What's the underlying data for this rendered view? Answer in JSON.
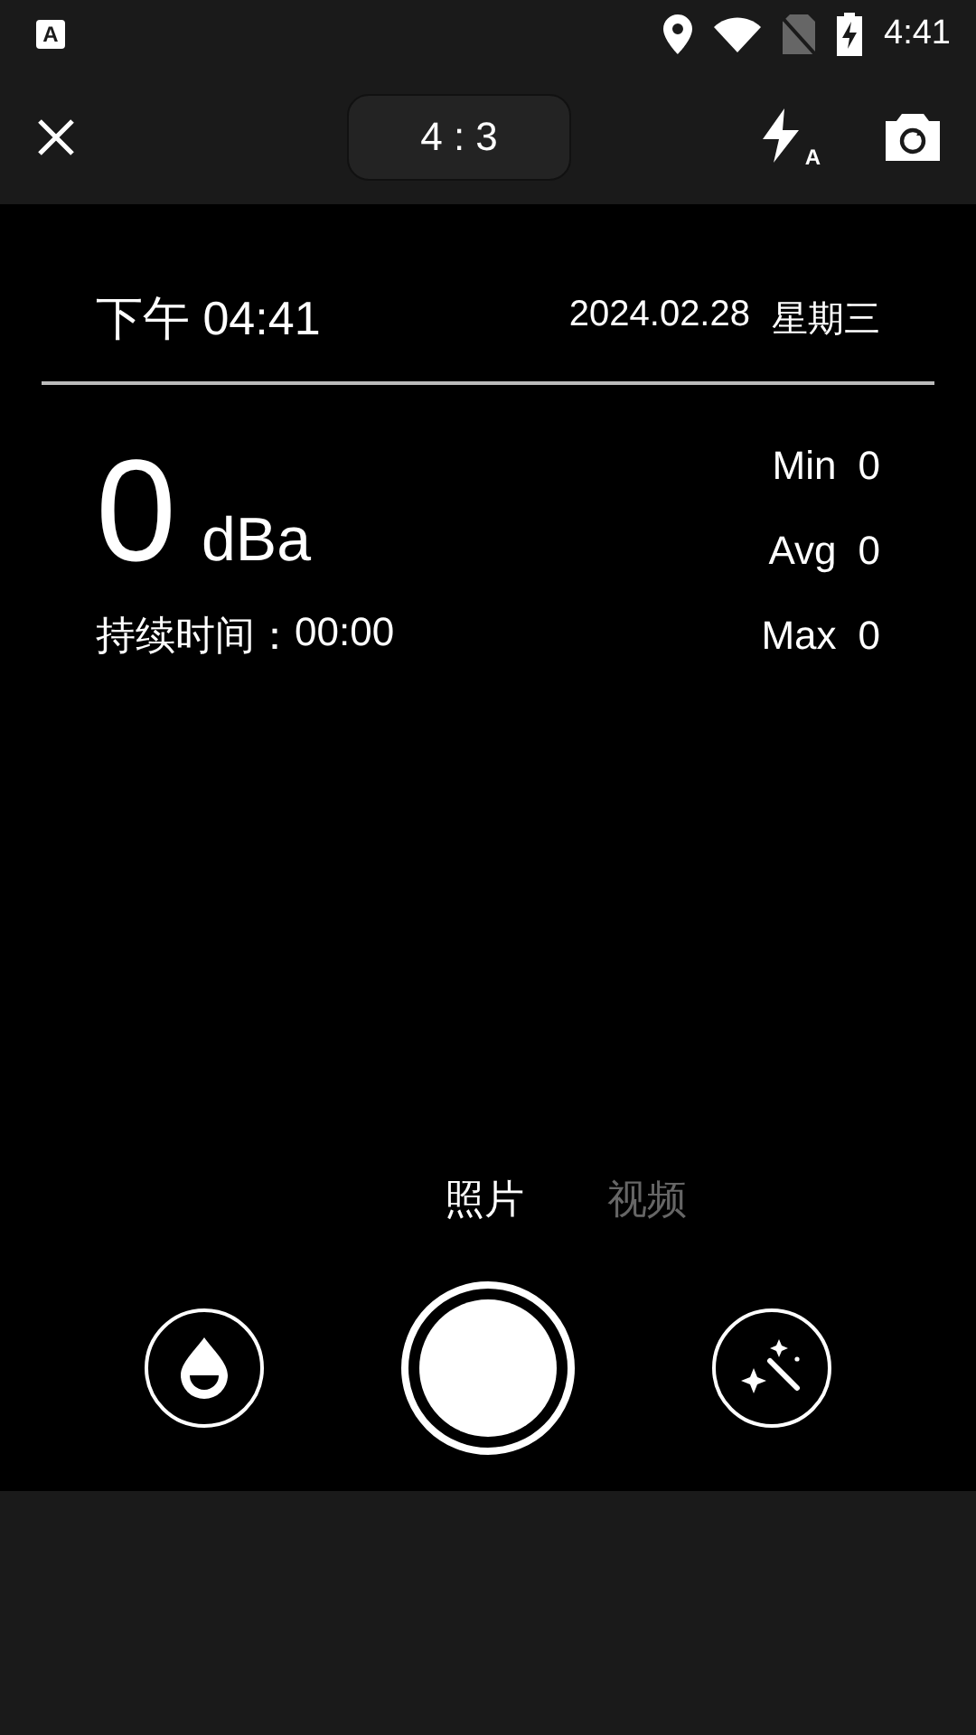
{
  "status_bar": {
    "notification": "A",
    "time": "4:41"
  },
  "top_bar": {
    "aspect_ratio": "4 : 3",
    "flash_mode": "A"
  },
  "meter": {
    "time": "下午 04:41",
    "date": "2024.02.28",
    "weekday": "星期三",
    "value": "0",
    "unit": "dBa",
    "duration_label": "持续时间：",
    "duration": "00:00",
    "stats": [
      {
        "label": "Min",
        "value": "0"
      },
      {
        "label": "Avg",
        "value": "0"
      },
      {
        "label": "Max",
        "value": "0"
      }
    ]
  },
  "modes": [
    {
      "label": "照片",
      "selected": true
    },
    {
      "label": "视频",
      "selected": false
    }
  ]
}
